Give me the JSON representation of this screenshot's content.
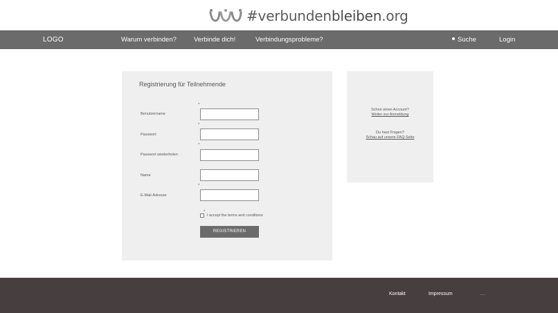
{
  "brand": {
    "hashtag_light": "#verbunden",
    "hashtag_strong": "bleiben",
    "suffix": ".org"
  },
  "nav": {
    "logo": "LOGO",
    "items": [
      {
        "label": "Warum verbinden?"
      },
      {
        "label": "Verbinde dich!"
      },
      {
        "label": "Verbindungsprobleme?"
      }
    ],
    "search": "Suche",
    "login": "Login"
  },
  "registration": {
    "title": "Registrierung für Teilnehmende",
    "fields": [
      {
        "label": "Benutzername",
        "required": "*",
        "value": "",
        "placeholder": ""
      },
      {
        "label": "Passwort",
        "required": "*",
        "value": "",
        "placeholder": ""
      },
      {
        "label": "Passwort wiederholen",
        "required": "*",
        "value": "",
        "placeholder": ""
      },
      {
        "label": "Name",
        "required": "",
        "value": "",
        "placeholder": ""
      },
      {
        "label": "E-Mail-Adresse",
        "required": "*",
        "value": "",
        "placeholder": ""
      }
    ],
    "terms_required": "*",
    "terms_label": "I accept the terms and conditions",
    "submit": "REGISTRIEREN"
  },
  "side": {
    "account_question": "Schon einen Account?",
    "account_link": "Weiter zur Anmeldung",
    "faq_question": "Du hast Fragen?",
    "faq_link": "Schau auf unsere FAQ-Seite"
  },
  "footer": {
    "contact": "Kontakt",
    "impressum": "Impressum",
    "more": "...."
  },
  "colors": {
    "navbar": "#6b6b6b",
    "panel": "#efefef",
    "footer": "#473f3f",
    "button": "#6b6b6b"
  }
}
